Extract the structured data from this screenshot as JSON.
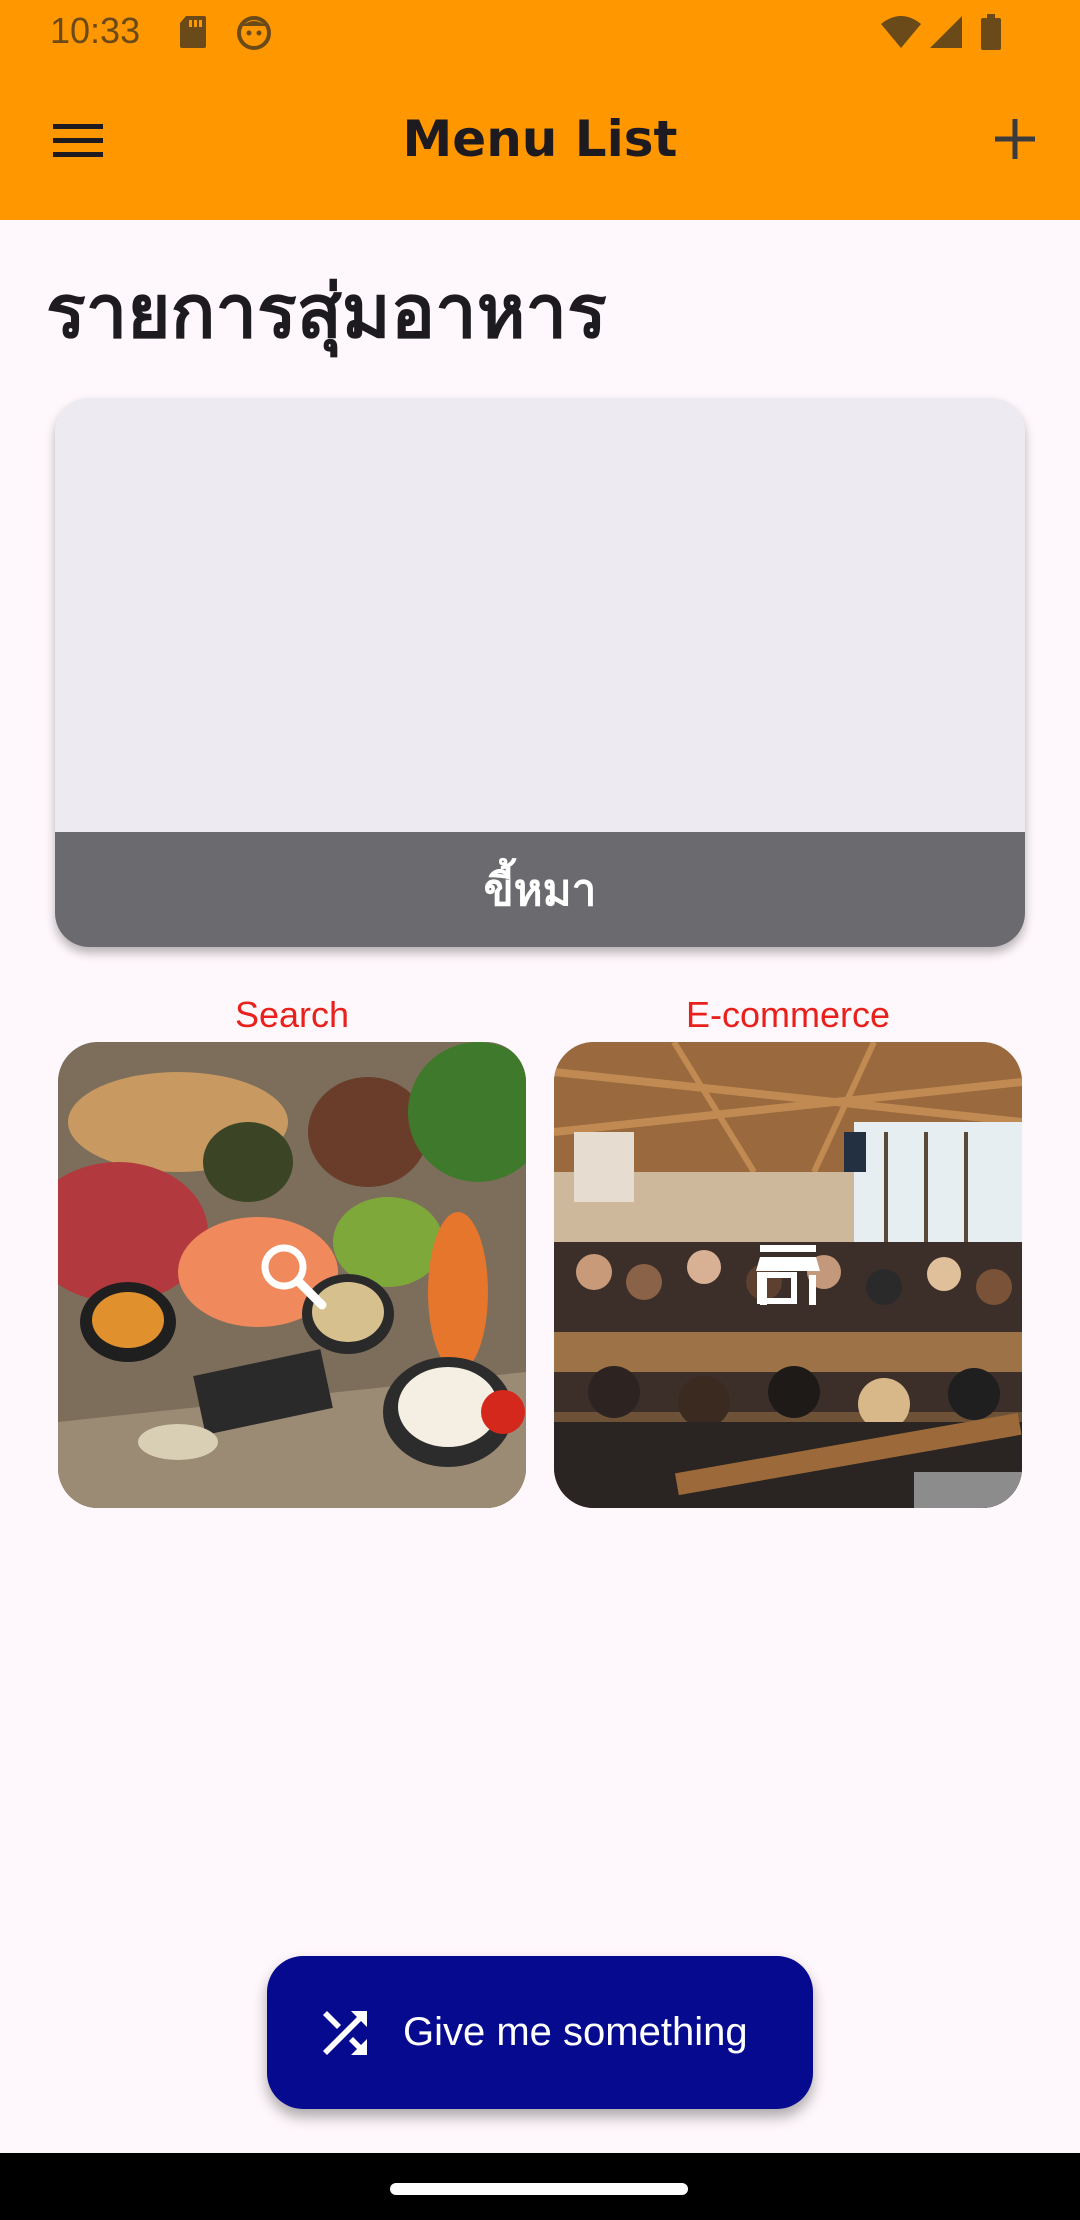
{
  "status_bar": {
    "time": "10:33",
    "left_icons": [
      "sd-card-icon",
      "face-icon"
    ],
    "right_icons": [
      "wifi-icon",
      "signal-icon",
      "battery-icon"
    ]
  },
  "app_bar": {
    "title": "Menu List",
    "menu_icon": "hamburger-menu-icon",
    "add_icon": "plus-icon",
    "background": "#ff9800"
  },
  "page": {
    "heading": "รายการสุ่มอาหาร"
  },
  "random_card": {
    "footer_label": "ขี้หมา",
    "image_background": "#eeeaf1",
    "footer_background": "#6b6a6e"
  },
  "tiles": [
    {
      "label": "Search",
      "icon": "search-icon",
      "image": "food-ingredients-photo"
    },
    {
      "label": "E-commerce",
      "icon": "store-icon",
      "image": "restaurant-crowd-photo"
    }
  ],
  "tile_label_color": "#e8211c",
  "fab": {
    "label": "Give me something",
    "icon": "shuffle-icon",
    "background": "#050a8f"
  }
}
